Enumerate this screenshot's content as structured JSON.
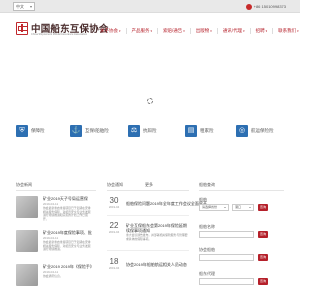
{
  "topbar": {
    "language": "中文",
    "phone": "+86 15010998373"
  },
  "header": {
    "logo_cn": "中国船东互保协会",
    "logo_en": "China Shipowners Mutual Assurance Association"
  },
  "nav": {
    "items": [
      {
        "label": "关于协会"
      },
      {
        "label": "产品服务"
      },
      {
        "label": "索赔/通告"
      },
      {
        "label": "出版物"
      },
      {
        "label": "通讯/代理"
      },
      {
        "label": "招聘"
      },
      {
        "label": "联系我们"
      }
    ]
  },
  "services": [
    {
      "label": "保障险"
    },
    {
      "label": "互保/船舶险"
    },
    {
      "label": "抗辩险"
    },
    {
      "label": "租家险"
    },
    {
      "label": "航运保险险"
    }
  ],
  "news": {
    "heading": "协会新闻",
    "items": [
      {
        "title": "矿业2019天子号局运营保",
        "date": "2019-04-11",
        "desc": "协会最新重启重载项目已于近期在安排相关服务保障、对船员安全与业务发展进行持续推进和完善的计划工作已展开。"
      },
      {
        "title": "矿业2019年度保险事项、批",
        "date": "2019-04-11",
        "desc": "协会最新重启重载项目已于近期在安排相关服务保障、对船员安全与业务发展进行持续推进。"
      },
      {
        "title": "矿业2019 2019年《保险手》",
        "date": "2019-04-11",
        "desc": "协会通讯信息。"
      }
    ]
  },
  "notices": {
    "heading": "协会通知",
    "tab2": "更多",
    "items": [
      {
        "day": "30",
        "ym": "2019-04",
        "title": "船舶保险问题2019年全年度工作会议全面展开",
        "desc": ""
      },
      {
        "day": "22",
        "ym": "2019-04",
        "title": "矿业互保船东会第2019年保险延期续保事项通知",
        "desc": "重大会议通告发布，并部署相关保险服务与管理要求具体的保障事项。"
      },
      {
        "day": "18",
        "ym": "2019-04",
        "title": "协会2019年船舶航运相关人员动态",
        "desc": ""
      }
    ]
  },
  "search": {
    "heading": "船舶查询",
    "region_label": "船舶",
    "select1": "请选择省份",
    "select2": "港口",
    "button": "查询",
    "field2_label": "船舶名称",
    "field3_label": "协会船舶",
    "field4_label": "船东代理"
  }
}
